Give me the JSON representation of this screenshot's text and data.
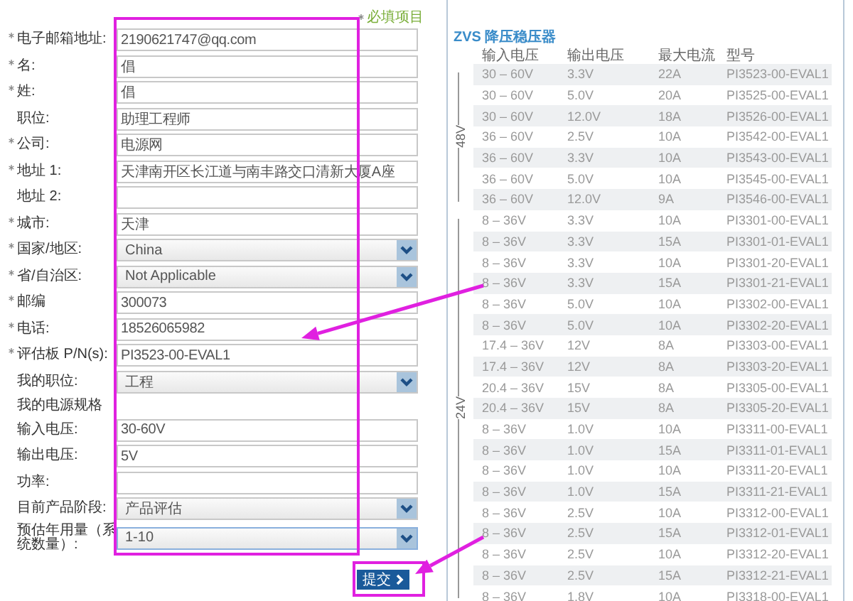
{
  "form": {
    "required_note": "必填项目",
    "fields": [
      {
        "label": "电子邮箱地址:",
        "required": true,
        "kind": "text",
        "value": "2190621747@qq.com"
      },
      {
        "label": "名:",
        "required": true,
        "kind": "text",
        "value": "倡"
      },
      {
        "label": "姓:",
        "required": true,
        "kind": "text",
        "value": "倡"
      },
      {
        "label": "职位:",
        "required": false,
        "kind": "text",
        "value": "助理工程师"
      },
      {
        "label": "公司:",
        "required": true,
        "kind": "text",
        "value": "电源网"
      },
      {
        "label": "地址 1:",
        "required": true,
        "kind": "text",
        "value": "天津南开区长江道与南丰路交口清新大厦A座"
      },
      {
        "label": "地址 2:",
        "required": false,
        "kind": "text"
      },
      {
        "label": "城市:",
        "required": true,
        "kind": "text",
        "value": "天津"
      },
      {
        "label": "国家/地区:",
        "required": true,
        "kind": "select",
        "value": "China"
      },
      {
        "label": "省/自治区:",
        "required": true,
        "kind": "select",
        "value": "Not Applicable"
      },
      {
        "label": "邮编",
        "required": true,
        "kind": "text",
        "value": "300073"
      },
      {
        "label": "电话:",
        "required": true,
        "kind": "text",
        "value": "18526065982"
      },
      {
        "label": "评估板 P/N(s):",
        "required": true,
        "kind": "text",
        "value": "PI3523-00-EVAL1"
      },
      {
        "label": "我的职位:",
        "required": false,
        "kind": "select",
        "value": "工程"
      },
      {
        "label": "我的电源规格",
        "required": false,
        "kind": "heading"
      },
      {
        "label": "输入电压:",
        "required": false,
        "kind": "text",
        "value": "30-60V"
      },
      {
        "label": "输出电压:",
        "required": false,
        "kind": "text",
        "value": "5V"
      },
      {
        "label": "功率:",
        "required": false,
        "kind": "text"
      },
      {
        "label": "目前产品阶段:",
        "required": false,
        "kind": "select",
        "value": "产品评估"
      },
      {
        "label": "预估年用量（系统数量）:",
        "required": false,
        "kind": "select",
        "value": "1-10"
      }
    ],
    "submit": "提交"
  },
  "table": {
    "title": "ZVS 降压稳压器",
    "columns": [
      "输入电压",
      "输出电压",
      "最大电流",
      "型号"
    ],
    "groups": [
      {
        "label": "48V",
        "rows": [
          [
            "30 – 60V",
            "3.3V",
            "22A",
            "PI3523-00-EVAL1"
          ],
          [
            "30 – 60V",
            "5.0V",
            "20A",
            "PI3525-00-EVAL1"
          ],
          [
            "30 – 60V",
            "12.0V",
            "18A",
            "PI3526-00-EVAL1"
          ],
          [
            "36 – 60V",
            "2.5V",
            "10A",
            "PI3542-00-EVAL1"
          ],
          [
            "36 – 60V",
            "3.3V",
            "10A",
            "PI3543-00-EVAL1"
          ],
          [
            "36 – 60V",
            "5.0V",
            "10A",
            "PI3545-00-EVAL1"
          ],
          [
            "36 – 60V",
            "12.0V",
            "9A",
            "PI3546-00-EVAL1"
          ]
        ]
      },
      {
        "label": "24V",
        "rows": [
          [
            "8 – 36V",
            "3.3V",
            "10A",
            "PI3301-00-EVAL1"
          ],
          [
            "8 – 36V",
            "3.3V",
            "15A",
            "PI3301-01-EVAL1"
          ],
          [
            "8 – 36V",
            "3.3V",
            "10A",
            "PI3301-20-EVAL1"
          ],
          [
            "8 – 36V",
            "3.3V",
            "15A",
            "PI3301-21-EVAL1"
          ],
          [
            "8 – 36V",
            "5.0V",
            "10A",
            "PI3302-00-EVAL1"
          ],
          [
            "8 – 36V",
            "5.0V",
            "10A",
            "PI3302-20-EVAL1"
          ],
          [
            "17.4 – 36V",
            "12V",
            "8A",
            "PI3303-00-EVAL1"
          ],
          [
            "17.4 – 36V",
            "12V",
            "8A",
            "PI3303-20-EVAL1"
          ],
          [
            "20.4 – 36V",
            "15V",
            "8A",
            "PI3305-00-EVAL1"
          ],
          [
            "20.4 – 36V",
            "15V",
            "8A",
            "PI3305-20-EVAL1"
          ],
          [
            "8 – 36V",
            "1.0V",
            "10A",
            "PI3311-00-EVAL1"
          ],
          [
            "8 – 36V",
            "1.0V",
            "15A",
            "PI3311-01-EVAL1"
          ],
          [
            "8 – 36V",
            "1.0V",
            "10A",
            "PI3311-20-EVAL1"
          ],
          [
            "8 – 36V",
            "1.0V",
            "15A",
            "PI3311-21-EVAL1"
          ],
          [
            "8 – 36V",
            "2.5V",
            "10A",
            "PI3312-00-EVAL1"
          ],
          [
            "8 – 36V",
            "2.5V",
            "15A",
            "PI3312-01-EVAL1"
          ],
          [
            "8 – 36V",
            "2.5V",
            "10A",
            "PI3312-20-EVAL1"
          ],
          [
            "8 – 36V",
            "2.5V",
            "15A",
            "PI3312-21-EVAL1"
          ],
          [
            "8 – 36V",
            "1.8V",
            "10A",
            "PI3318-00-EVAL1"
          ]
        ]
      }
    ]
  }
}
